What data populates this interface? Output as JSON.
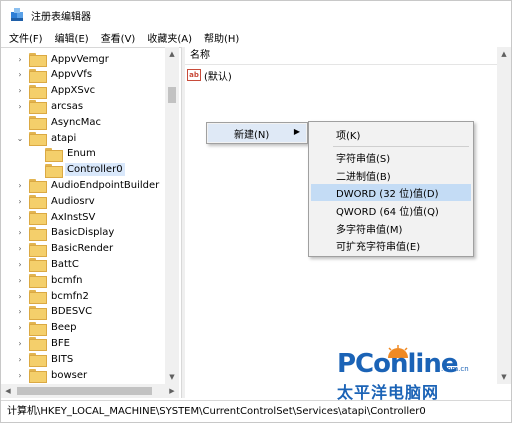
{
  "window": {
    "title": "注册表编辑器"
  },
  "menubar": {
    "items": [
      "文件(F)",
      "编辑(E)",
      "查看(V)",
      "收藏夹(A)",
      "帮助(H)"
    ]
  },
  "tree": {
    "items": [
      {
        "label": "AppvVemgr",
        "expander": "›",
        "selected": false
      },
      {
        "label": "AppvVfs",
        "expander": "›",
        "selected": false
      },
      {
        "label": "AppXSvc",
        "expander": "›",
        "selected": false
      },
      {
        "label": "arcsas",
        "expander": "›",
        "selected": false
      },
      {
        "label": "AsyncMac",
        "expander": "",
        "selected": false
      },
      {
        "label": "atapi",
        "expander": "⌄",
        "selected": false
      },
      {
        "label": "Enum",
        "expander": "",
        "selected": false
      },
      {
        "label": "Controller0",
        "expander": "",
        "selected": true
      },
      {
        "label": "AudioEndpointBuilder",
        "expander": "›",
        "selected": false
      },
      {
        "label": "Audiosrv",
        "expander": "›",
        "selected": false
      },
      {
        "label": "AxInstSV",
        "expander": "›",
        "selected": false
      },
      {
        "label": "BasicDisplay",
        "expander": "›",
        "selected": false
      },
      {
        "label": "BasicRender",
        "expander": "›",
        "selected": false
      },
      {
        "label": "BattC",
        "expander": "›",
        "selected": false
      },
      {
        "label": "bcmfn",
        "expander": "›",
        "selected": false
      },
      {
        "label": "bcmfn2",
        "expander": "›",
        "selected": false
      },
      {
        "label": "BDESVC",
        "expander": "›",
        "selected": false
      },
      {
        "label": "Beep",
        "expander": "›",
        "selected": false
      },
      {
        "label": "BFE",
        "expander": "›",
        "selected": false
      },
      {
        "label": "BITS",
        "expander": "›",
        "selected": false
      },
      {
        "label": "bowser",
        "expander": "›",
        "selected": false
      }
    ]
  },
  "values": {
    "column_name": "名称",
    "rows": [
      {
        "icon": "ab",
        "name": "(默认)"
      }
    ]
  },
  "context_menu": {
    "new_label": "新建(N)",
    "submenu": {
      "key": "项(K)",
      "string": "字符串值(S)",
      "binary": "二进制值(B)",
      "dword": "DWORD (32 位)值(D)",
      "qword": "QWORD (64 位)值(Q)",
      "multi_string": "多字符串值(M)",
      "expand_string": "可扩充字符串值(E)"
    },
    "highlighted": "dword"
  },
  "statusbar": {
    "path": "计算机\\HKEY_LOCAL_MACHINE\\SYSTEM\\CurrentControlSet\\Services\\atapi\\Controller0"
  },
  "watermark": {
    "brand": "PConline",
    "domain": ".com.cn",
    "chinese": "太平洋电脑网"
  },
  "colors": {
    "selection": "#d9e8fb",
    "menu_highlight": "#c4dcf5",
    "folder": "#f4cf6b",
    "watermark": "#1b63b6"
  }
}
